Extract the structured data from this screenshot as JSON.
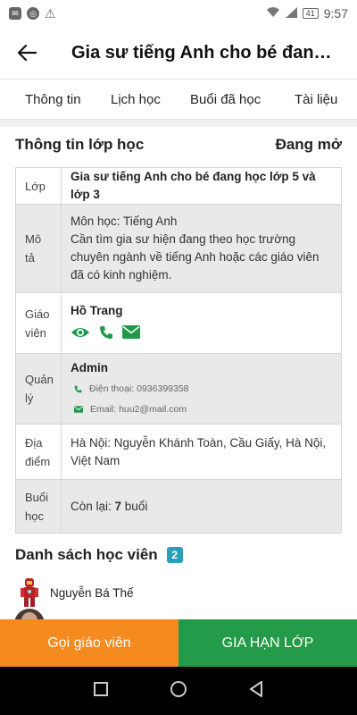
{
  "status_bar": {
    "time": "9:57",
    "battery": "41"
  },
  "header": {
    "title": "Gia sư tiếng Anh cho bé đang học lớp 5 và lớp 3"
  },
  "tabs": [
    "Thông tin",
    "Lịch học",
    "Buổi đã học",
    "Tài liệu"
  ],
  "class_info": {
    "heading": "Thông tin lớp học",
    "status": "Đang mở",
    "rows": {
      "lop": {
        "label": "Lớp",
        "value": "Gia sư tiếng Anh cho bé đang học lớp 5 và lớp 3"
      },
      "mota": {
        "label": "Mô tả",
        "subject": "Môn học: Tiếng Anh",
        "description": "Cần tìm gia sư hiện đang theo học trường chuyên ngành về tiếng Anh hoặc các giáo viên đã có kinh nghiệm."
      },
      "giaovien": {
        "label": "Giáo viên",
        "name": "Hồ Trang"
      },
      "quanly": {
        "label": "Quản lý",
        "name": "Admin",
        "phone": "Điện thoại: 0936399358",
        "email": "Email: huu2@mail.com"
      },
      "diadiem": {
        "label": "Địa điểm",
        "value": "Hà Nội: Nguyễn Khánh Toàn, Cầu Giấy, Hà Nội, Việt Nam"
      },
      "buoihoc": {
        "label": "Buổi học",
        "prefix": "Còn lại: ",
        "count": "7",
        "suffix": " buổi"
      }
    }
  },
  "students": {
    "heading": "Danh sách học viên",
    "count": "2",
    "items": [
      {
        "name": "Nguyễn Bá Thế"
      }
    ]
  },
  "actions": {
    "call_teacher": "Gọi giáo viên",
    "renew_class": "GIA HẠN LỚP"
  },
  "colors": {
    "orange": "#f58a1f",
    "green": "#239b48",
    "badge": "#2a9fb8",
    "icon_green": "#1e9a4a"
  }
}
